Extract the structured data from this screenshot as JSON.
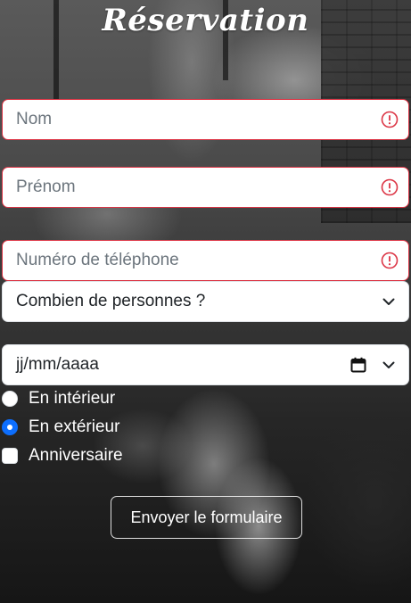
{
  "form": {
    "title": "Réservation",
    "fields": {
      "nom": {
        "placeholder": "Nom",
        "value": ""
      },
      "prenom": {
        "placeholder": "Prénom",
        "value": ""
      },
      "telephone": {
        "placeholder": "Numéro de téléphone",
        "value": ""
      }
    },
    "people_select": {
      "selected": "Combien de personnes ?"
    },
    "date": {
      "placeholder": "jj/mm/aaaa"
    },
    "options": {
      "interieur": {
        "label": "En intérieur",
        "checked": false
      },
      "exterieur": {
        "label": "En extérieur",
        "checked": true
      },
      "anniversaire": {
        "label": "Anniversaire",
        "checked": false
      }
    },
    "submit_label": "Envoyer le formulaire"
  },
  "colors": {
    "invalid_border": "#dc3545",
    "radio_checked": "#0d6efd",
    "placeholder": "#6c757d"
  },
  "icons": [
    "exclamation-circle-icon",
    "chevron-down-icon",
    "calendar-icon"
  ]
}
